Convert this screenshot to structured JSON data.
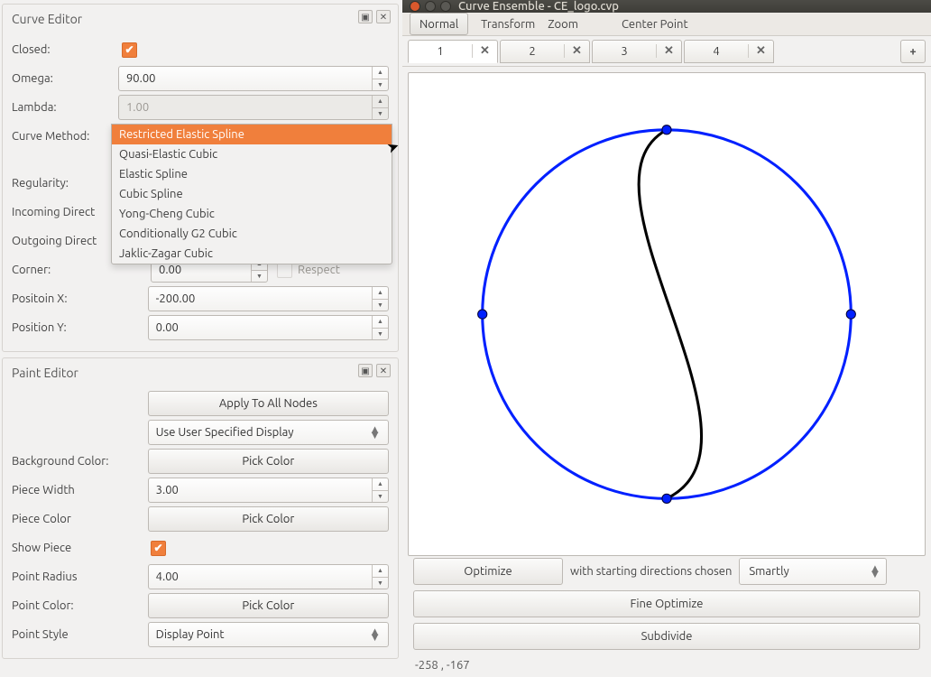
{
  "curveEditor": {
    "title": "Curve Editor",
    "closedLabel": "Closed:",
    "closedChecked": true,
    "omegaLabel": "Omega:",
    "omegaValue": "90.00",
    "lambdaLabel": "Lambda:",
    "lambdaValue": "1.00",
    "curveMethodLabel": "Curve Method:",
    "curveMethodSelected": "Restricted Elastic Spline",
    "curveMethodOptions": [
      "Restricted Elastic Spline",
      "Quasi-Elastic Cubic",
      "Elastic Spline",
      "Cubic Spline",
      "Yong-Cheng Cubic",
      "Conditionally G2 Cubic",
      "Jaklic-Zagar Cubic"
    ],
    "regularityLabel": "Regularity:",
    "incomingDirLabel": "Incoming Direct",
    "outgoingDirLabel": "Outgoing Direct",
    "cornerLabel": "Corner:",
    "cornerValue": "0.00",
    "respectLabel": "Respect",
    "posXLabel": "Positoin X:",
    "posXValue": "-200.00",
    "posYLabel": "Position Y:",
    "posYValue": "0.00"
  },
  "paintEditor": {
    "title": "Paint Editor",
    "applyAll": "Apply To All Nodes",
    "displayMode": "Use User Specified Display",
    "bgColorLabel": "Background Color:",
    "pieceWidthLabel": "Piece Width",
    "pieceWidthValue": "3.00",
    "pieceColorLabel": "Piece Color",
    "showPieceLabel": "Show Piece",
    "showPieceChecked": true,
    "pointRadiusLabel": "Point Radius",
    "pointRadiusValue": "4.00",
    "pointColorLabel": "Point Color:",
    "pointStyleLabel": "Point Style",
    "pointStyleValue": "Display Point",
    "pickColor": "Pick Color"
  },
  "main": {
    "windowTitle": "Curve Ensemble - CE_logo.cvp",
    "toolbar": {
      "normal": "Normal",
      "transform": "Transform",
      "zoom": "Zoom",
      "centerPoint": "Center Point"
    },
    "tabs": [
      "1",
      "2",
      "3",
      "4"
    ],
    "activeTab": 0,
    "optimize": "Optimize",
    "withLabel": "with starting directions chosen",
    "smartly": "Smartly",
    "fineOptimize": "Fine Optimize",
    "subdivide": "Subdivide",
    "coords": "-258 , -167"
  }
}
